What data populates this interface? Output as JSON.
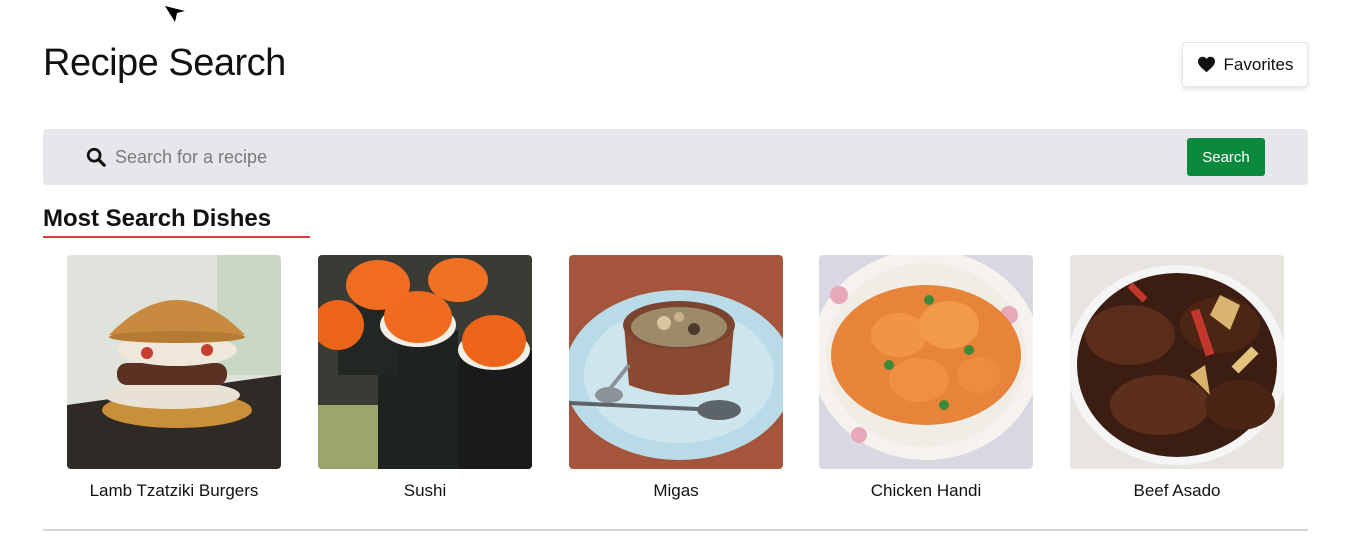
{
  "header": {
    "title": "Recipe Search",
    "favorites_label": "Favorites"
  },
  "search": {
    "placeholder": "Search for a recipe",
    "value": "",
    "button_label": "Search"
  },
  "section": {
    "title": "Most Search Dishes"
  },
  "dishes": [
    {
      "name": "Lamb Tzatziki Burgers"
    },
    {
      "name": "Sushi"
    },
    {
      "name": "Migas"
    },
    {
      "name": "Chicken Handi"
    },
    {
      "name": "Beef Asado"
    }
  ],
  "colors": {
    "search_button": "#0b8a3e",
    "underline_accent": "#e0353b",
    "search_bar_bg": "#e6e7ea"
  }
}
